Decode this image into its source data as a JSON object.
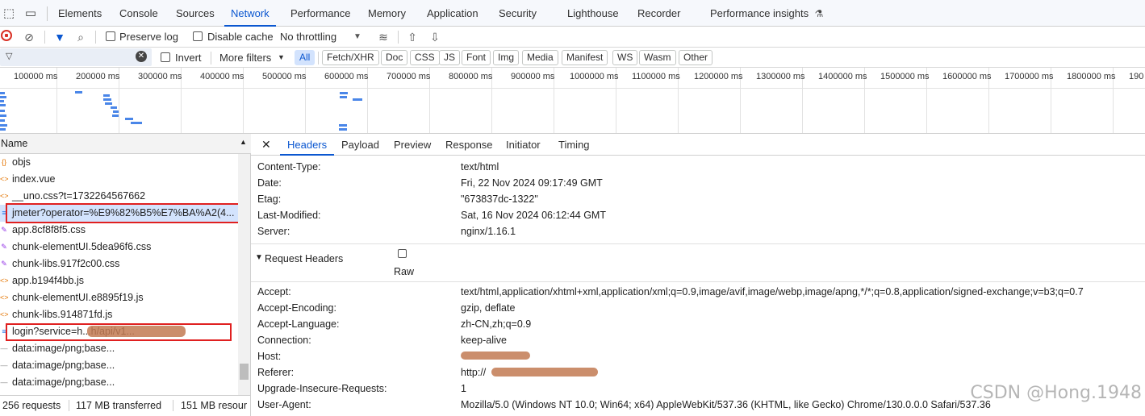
{
  "tabs": {
    "items": [
      "Elements",
      "Console",
      "Sources",
      "Network",
      "Performance",
      "Memory",
      "Application",
      "Security",
      "Lighthouse",
      "Recorder",
      "Performance insights"
    ],
    "active": "Network"
  },
  "toolbar": {
    "preserve_log": "Preserve log",
    "disable_cache": "Disable cache",
    "throttling": "No throttling"
  },
  "filter": {
    "invert": "Invert",
    "more_filters": "More filters",
    "chips": [
      "All",
      "Fetch/XHR",
      "Doc",
      "CSS",
      "JS",
      "Font",
      "Img",
      "Media",
      "Manifest",
      "WS",
      "Wasm",
      "Other"
    ],
    "selected": "All"
  },
  "timeline": {
    "ticks": [
      "100000 ms",
      "200000 ms",
      "300000 ms",
      "400000 ms",
      "500000 ms",
      "600000 ms",
      "700000 ms",
      "800000 ms",
      "900000 ms",
      "1000000 ms",
      "1100000 ms",
      "1200000 ms",
      "1300000 ms",
      "1400000 ms",
      "1500000 ms",
      "1600000 ms",
      "1700000 ms",
      "1800000 ms",
      "190"
    ]
  },
  "requests": {
    "column_name": "Name",
    "rows": [
      {
        "name": "objs",
        "type": "json"
      },
      {
        "name": "index.vue",
        "type": "script"
      },
      {
        "name": "__uno.css?t=1732264567662",
        "type": "script"
      },
      {
        "name": "jmeter?operator=%E9%82%B5%E7%BA%A2(4...",
        "type": "doc"
      },
      {
        "name": "app.8cf8f8f5.css",
        "type": "css"
      },
      {
        "name": "chunk-elementUI.5dea96f6.css",
        "type": "css"
      },
      {
        "name": "chunk-libs.917f2c00.css",
        "type": "css"
      },
      {
        "name": "app.b194f4bb.js",
        "type": "script"
      },
      {
        "name": "chunk-elementUI.e8895f19.js",
        "type": "script"
      },
      {
        "name": "chunk-libs.914871fd.js",
        "type": "script"
      },
      {
        "name": "login?service=h...h/api/v1...",
        "type": "doc"
      },
      {
        "name": "data:image/png;base...",
        "type": "img"
      },
      {
        "name": "data:image/png;base...",
        "type": "img"
      },
      {
        "name": "data:image/png;base...",
        "type": "img"
      }
    ],
    "selected_index": 3
  },
  "status": {
    "requests": "256 requests",
    "transferred": "117 MB transferred",
    "resources": "151 MB resour"
  },
  "detail": {
    "tabs": [
      "Headers",
      "Payload",
      "Preview",
      "Response",
      "Initiator",
      "Timing"
    ],
    "active_tab": "Headers",
    "response_headers": [
      {
        "key": "Content-Type:",
        "value": "text/html"
      },
      {
        "key": "Date:",
        "value": "Fri, 22 Nov 2024 09:17:49 GMT"
      },
      {
        "key": "Etag:",
        "value": "\"673837dc-1322\""
      },
      {
        "key": "Last-Modified:",
        "value": "Sat, 16 Nov 2024 06:12:44 GMT"
      },
      {
        "key": "Server:",
        "value": "nginx/1.16.1"
      }
    ],
    "request_section_title": "Request Headers",
    "raw_label": "Raw",
    "request_headers": [
      {
        "key": "Accept:",
        "value": "text/html,application/xhtml+xml,application/xml;q=0.9,image/avif,image/webp,image/apng,*/*;q=0.8,application/signed-exchange;v=b3;q=0.7"
      },
      {
        "key": "Accept-Encoding:",
        "value": "gzip, deflate"
      },
      {
        "key": "Accept-Language:",
        "value": "zh-CN,zh;q=0.9"
      },
      {
        "key": "Connection:",
        "value": "keep-alive"
      },
      {
        "key": "Host:",
        "value": ""
      },
      {
        "key": "Referer:",
        "value": "http://"
      },
      {
        "key": "Upgrade-Insecure-Requests:",
        "value": "1"
      },
      {
        "key": "User-Agent:",
        "value": "Mozilla/5.0 (Windows NT 10.0; Win64; x64) AppleWebKit/537.36 (KHTML, like Gecko) Chrome/130.0.0.0 Safari/537.36"
      }
    ]
  },
  "watermark": "CSDN @Hong.1948",
  "colors": {
    "accent": "#0b57d0",
    "highlight": "#e02020",
    "selection": "#d3e3fd"
  }
}
